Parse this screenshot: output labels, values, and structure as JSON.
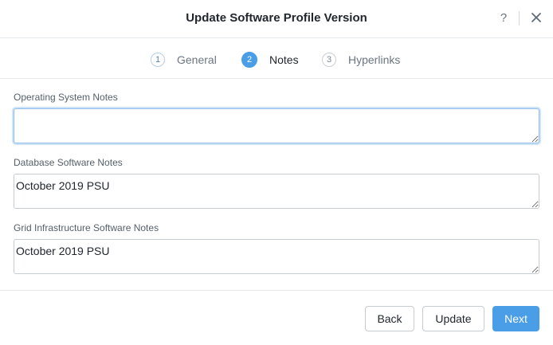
{
  "dialog": {
    "title": "Update Software Profile Version",
    "help_label": "?",
    "close_icon": "close-icon"
  },
  "steps": [
    {
      "number": "1",
      "label": "General",
      "state": "done"
    },
    {
      "number": "2",
      "label": "Notes",
      "state": "active"
    },
    {
      "number": "3",
      "label": "Hyperlinks",
      "state": "pending"
    }
  ],
  "fields": {
    "os_notes": {
      "label": "Operating System Notes",
      "value": ""
    },
    "db_notes": {
      "label": "Database Software Notes",
      "value": "October 2019 PSU"
    },
    "grid_notes": {
      "label": "Grid Infrastructure Software Notes",
      "value": "October 2019 PSU"
    }
  },
  "footer": {
    "back_label": "Back",
    "update_label": "Update",
    "next_label": "Next"
  },
  "colors": {
    "accent": "#4a9ee8",
    "border": "#c7ccd1"
  }
}
